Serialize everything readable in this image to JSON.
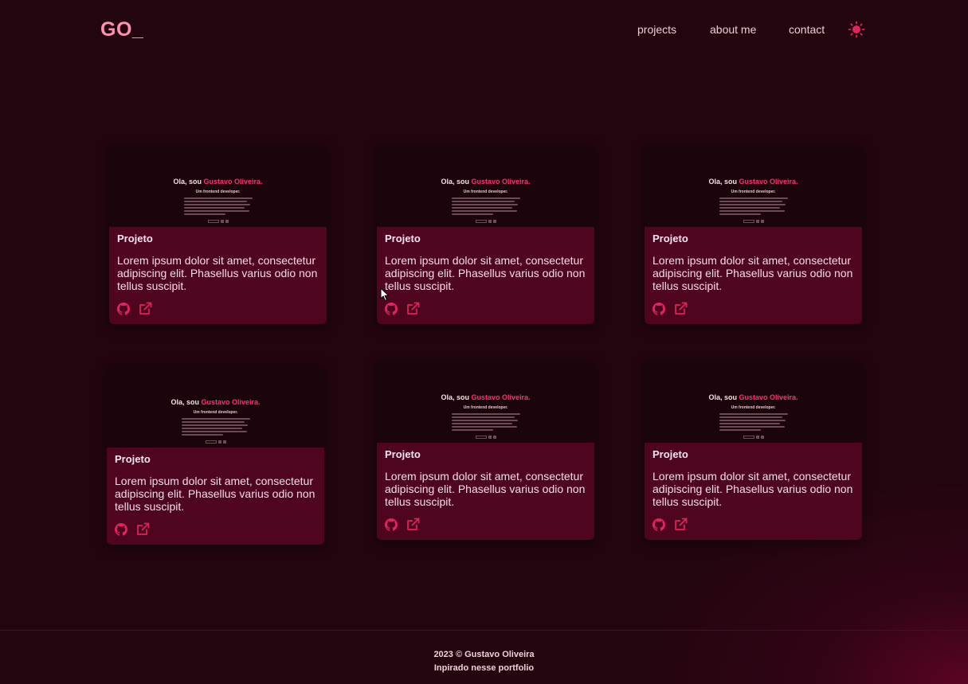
{
  "header": {
    "logo": "GO_",
    "nav": {
      "projects": "projects",
      "about": "about me",
      "contact": "contact"
    },
    "theme_icon": "sun-icon"
  },
  "projects": [
    {
      "thumb_title_prefix": "Ola, sou",
      "thumb_title_name": "Gustavo Oliveira.",
      "thumb_subtitle": "Um frontend developer.",
      "title": "Projeto",
      "description": "Lorem ipsum dolor sit amet, consectetur adipiscing elit. Phasellus varius odio non tellus suscipit."
    },
    {
      "thumb_title_prefix": "Ola, sou",
      "thumb_title_name": "Gustavo Oliveira.",
      "thumb_subtitle": "Um frontend developer.",
      "title": "Projeto",
      "description": "Lorem ipsum dolor sit amet, consectetur adipiscing elit. Phasellus varius odio non tellus suscipit."
    },
    {
      "thumb_title_prefix": "Ola, sou",
      "thumb_title_name": "Gustavo Oliveira.",
      "thumb_subtitle": "Um frontend developer.",
      "title": "Projeto",
      "description": "Lorem ipsum dolor sit amet, consectetur adipiscing elit. Phasellus varius odio non tellus suscipit."
    },
    {
      "thumb_title_prefix": "Ola, sou",
      "thumb_title_name": "Gustavo Oliveira.",
      "thumb_subtitle": "Um frontend developer.",
      "title": "Projeto",
      "description": "Lorem ipsum dolor sit amet, consectetur adipiscing elit. Phasellus varius odio non tellus suscipit."
    },
    {
      "thumb_title_prefix": "Ola, sou",
      "thumb_title_name": "Gustavo Oliveira.",
      "thumb_subtitle": "Um frontend developer.",
      "title": "Projeto",
      "description": "Lorem ipsum dolor sit amet, consectetur adipiscing elit. Phasellus varius odio non tellus suscipit."
    },
    {
      "thumb_title_prefix": "Ola, sou",
      "thumb_title_name": "Gustavo Oliveira.",
      "thumb_subtitle": "Um frontend developer.",
      "title": "Projeto",
      "description": "Lorem ipsum dolor sit amet, consectetur adipiscing elit. Phasellus varius odio non tellus suscipit."
    }
  ],
  "card_icons": {
    "source": "github-icon",
    "live": "external-link-icon"
  },
  "footer": {
    "copyright": "2023  © Gustavo Oliveira",
    "credit": "Inpirado nesse portfolio"
  },
  "colors": {
    "background": "#22050f",
    "card": "#4f0520",
    "accent": "#ff2f7a",
    "logo": "#ff8fb5"
  }
}
